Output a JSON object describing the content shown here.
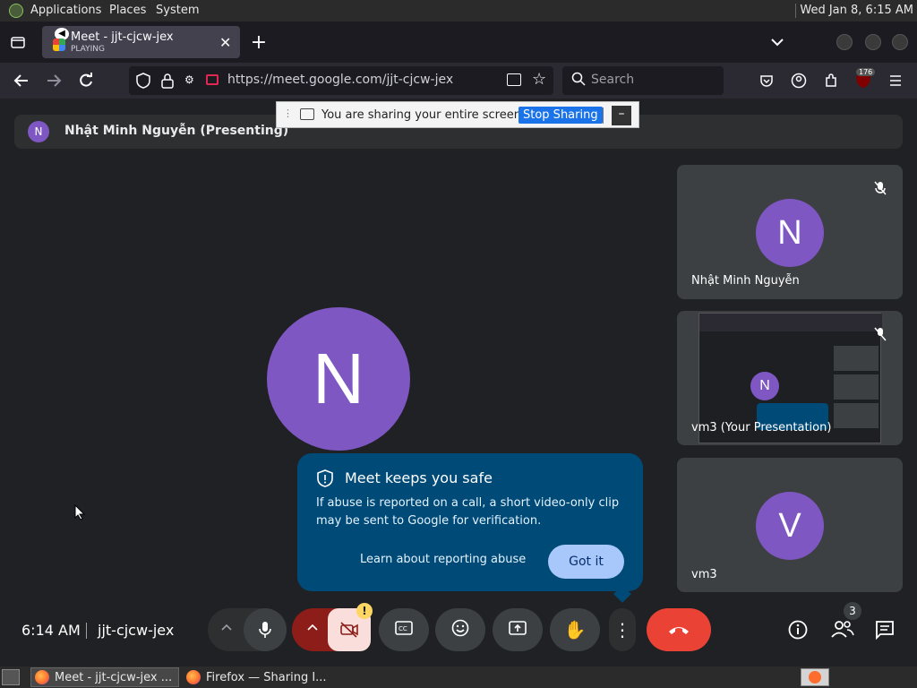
{
  "top_panel": {
    "menu": [
      "Applications",
      "Places",
      "System"
    ],
    "clock": "Wed Jan  8,  6:15 AM"
  },
  "browser": {
    "tab": {
      "title": "Meet - jjt-cjcw-jex",
      "status": "PLAYING"
    },
    "url": "https://meet.google.com/jjt-cjcw-jex",
    "search_placeholder": "Search",
    "badge_count": "176"
  },
  "share_notice": {
    "text": "You are sharing your entire screen.",
    "stop_label": "Stop Sharing"
  },
  "presenter_bar": {
    "initial": "N",
    "name": "Nhật Minh Nguyễn (Presenting)"
  },
  "main_avatar": "N",
  "tiles": [
    {
      "initial": "N",
      "label": "Nhật Minh Nguyễn"
    },
    {
      "initial": "N",
      "label": "vm3 (Your Presentation)"
    },
    {
      "initial": "V",
      "label": "vm3"
    }
  ],
  "safe_popup": {
    "title": "Meet keeps you safe",
    "body": "If abuse is reported on a call, a short video-only clip may be sent to Google for verification.",
    "learn_link": "Learn about reporting abuse",
    "got_it": "Got it"
  },
  "bottom_bar": {
    "time": "6:14 AM",
    "meeting_code": "jjt-cjcw-jex",
    "people_count": "3",
    "alert_glyph": "!"
  },
  "taskbar": {
    "items": [
      "Meet - jjt-cjcw-jex ...",
      "Firefox — Sharing I..."
    ]
  },
  "colors": {
    "accent": "#1a73e8",
    "hangup": "#ea4335",
    "avatar": "#7e57c2",
    "popup": "#004a77"
  }
}
